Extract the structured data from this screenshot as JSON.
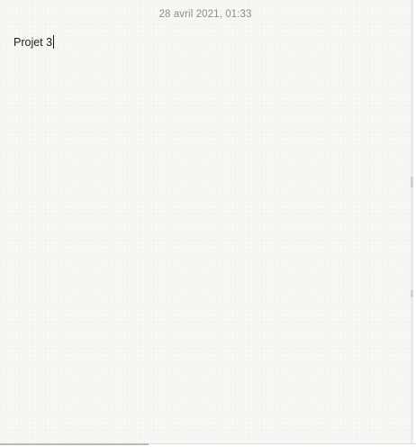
{
  "note": {
    "date": "28 avril 2021, 01:33",
    "body": "Projet 3"
  }
}
